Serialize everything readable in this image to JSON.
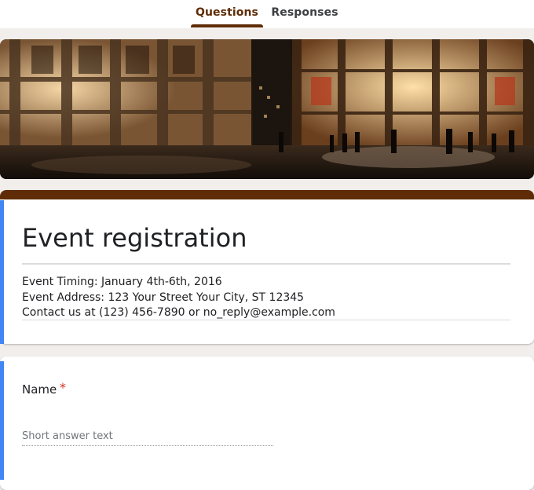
{
  "tabs": {
    "questions": "Questions",
    "responses": "Responses"
  },
  "theme": {
    "accent": "#5f2c07",
    "focus_blue": "#4285f4",
    "required_red": "#d93025"
  },
  "form": {
    "title": "Event registration",
    "description_lines": [
      "Event Timing: January 4th-6th, 2016",
      "Event Address: 123 Your Street Your City, ST 12345",
      "Contact us at (123) 456-7890 or no_reply@example.com"
    ]
  },
  "question": {
    "label": "Name",
    "required_mark": "*",
    "placeholder": "Short answer text"
  }
}
